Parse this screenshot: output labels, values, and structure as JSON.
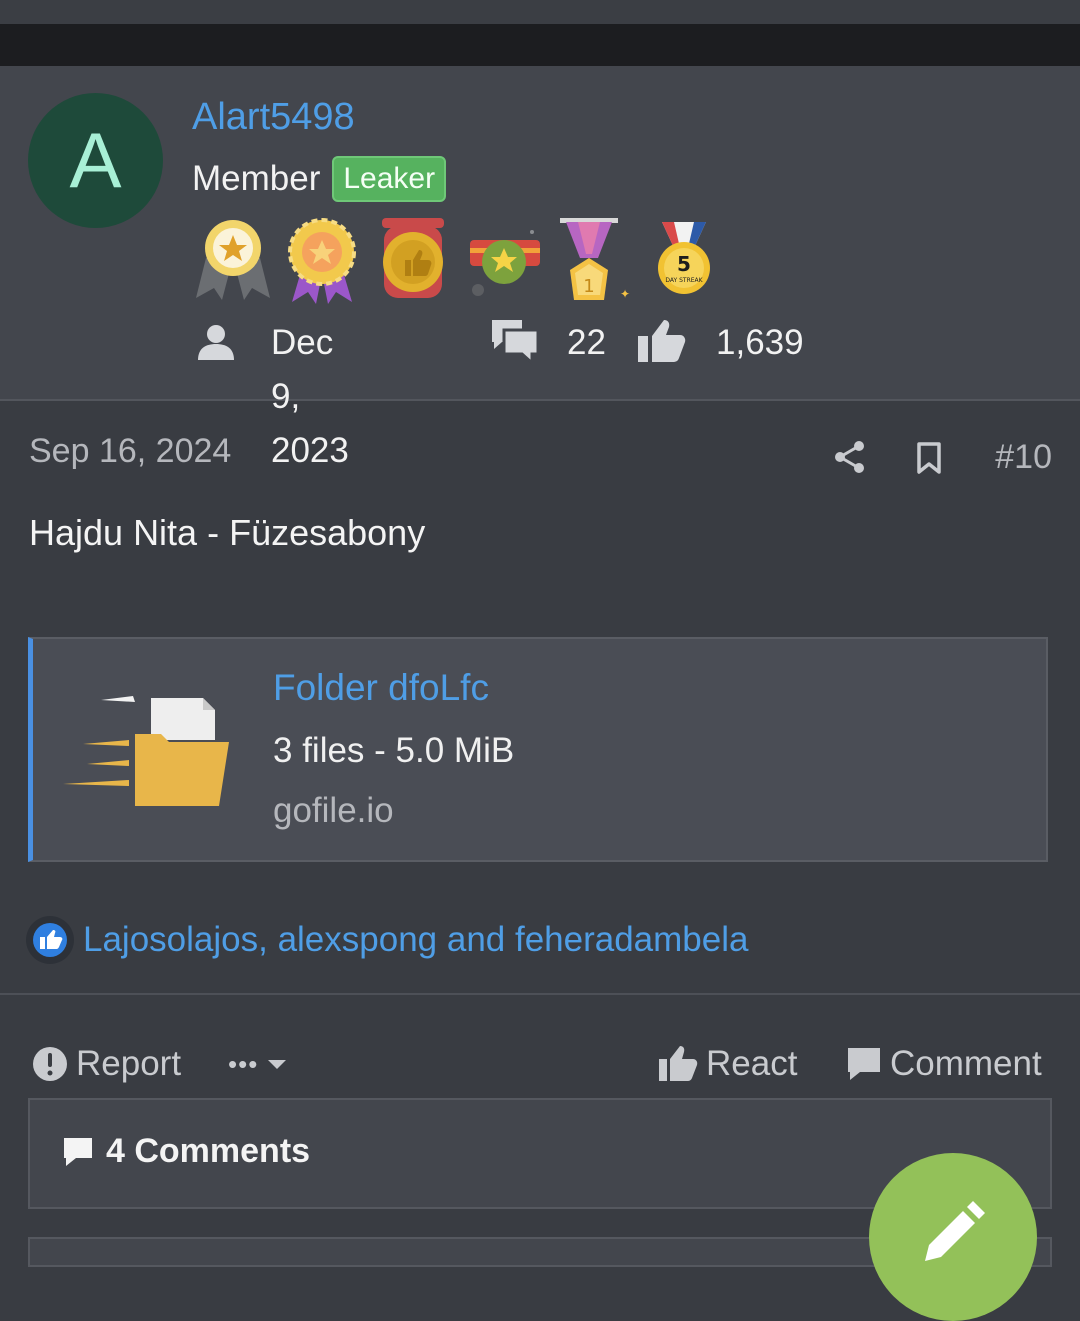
{
  "user": {
    "avatar_letter": "A",
    "username": "Alart5498",
    "role": "Member",
    "badge": "Leaker",
    "joined": "Dec 9, 2023",
    "messages": "22",
    "reactions": "1,639",
    "trophies": [
      "ribbon-star-trophy",
      "rosette-trophy",
      "thumbs-up-medal-trophy",
      "star-banner-trophy",
      "first-place-medal-trophy",
      "5-day-streak-trophy"
    ],
    "trophy_texts": {
      "streak_number": "5",
      "streak_label": "DAY STREAK",
      "first_place": "1"
    }
  },
  "post": {
    "date": "Sep 16, 2024",
    "number": "#10",
    "text": "Hajdu Nita - Füzesabony"
  },
  "embed": {
    "title": "Folder dfoLfc",
    "meta": "3 files - 5.0 MiB",
    "host": "gofile.io"
  },
  "reactions_line": "Lajosolajos, alexspong and feheradambela",
  "footer": {
    "report": "Report",
    "more": "•••",
    "react": "React",
    "comment": "Comment"
  },
  "comments": {
    "label": "4 Comments"
  },
  "colors": {
    "link": "#4f9ee6",
    "badge": "#56b25f",
    "fab": "#93c159",
    "avatar_bg": "#1e4a3a"
  }
}
